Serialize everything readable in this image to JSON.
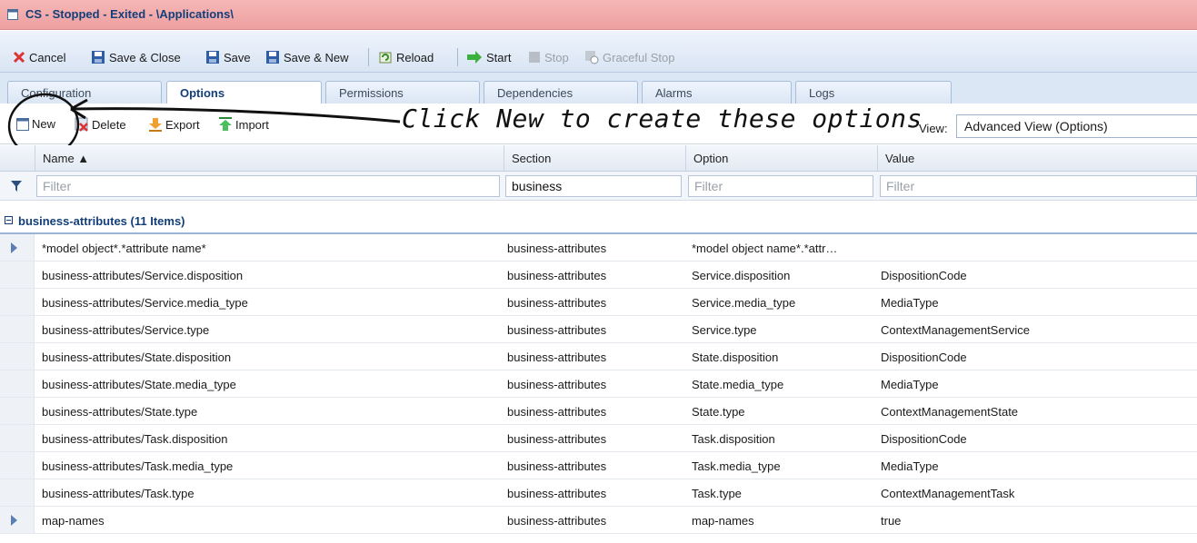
{
  "window": {
    "title": "CS - Stopped - Exited - \\Applications\\"
  },
  "toolbar": {
    "cancel": "Cancel",
    "save_close": "Save & Close",
    "save": "Save",
    "save_new": "Save & New",
    "reload": "Reload",
    "start": "Start",
    "stop": "Stop",
    "graceful_stop": "Graceful Stop"
  },
  "tabs": [
    "Configuration",
    "Options",
    "Permissions",
    "Dependencies",
    "Alarms",
    "Logs"
  ],
  "grid_toolbar": {
    "new": "New",
    "delete": "Delete",
    "export": "Export",
    "import": "Import",
    "view_label": "View:",
    "view_value": "Advanced View (Options)"
  },
  "annotation": "Click New to create these options",
  "columns": [
    "Name ▲",
    "Section",
    "Option",
    "Value"
  ],
  "filters": {
    "name": "Filter",
    "section": "business",
    "option": "Filter",
    "value": "Filter"
  },
  "group": {
    "label": "business-attributes (11 Items)"
  },
  "rows": [
    {
      "name": "*model object*.*attribute name*",
      "section": "business-attributes",
      "option": "*model object name*.*attr…",
      "value": ""
    },
    {
      "name": "business-attributes/Service.disposition",
      "section": "business-attributes",
      "option": "Service.disposition",
      "value": "DispositionCode"
    },
    {
      "name": "business-attributes/Service.media_type",
      "section": "business-attributes",
      "option": "Service.media_type",
      "value": "MediaType"
    },
    {
      "name": "business-attributes/Service.type",
      "section": "business-attributes",
      "option": "Service.type",
      "value": "ContextManagementService"
    },
    {
      "name": "business-attributes/State.disposition",
      "section": "business-attributes",
      "option": "State.disposition",
      "value": "DispositionCode"
    },
    {
      "name": "business-attributes/State.media_type",
      "section": "business-attributes",
      "option": "State.media_type",
      "value": "MediaType"
    },
    {
      "name": "business-attributes/State.type",
      "section": "business-attributes",
      "option": "State.type",
      "value": "ContextManagementState"
    },
    {
      "name": "business-attributes/Task.disposition",
      "section": "business-attributes",
      "option": "Task.disposition",
      "value": "DispositionCode"
    },
    {
      "name": "business-attributes/Task.media_type",
      "section": "business-attributes",
      "option": "Task.media_type",
      "value": "MediaType"
    },
    {
      "name": "business-attributes/Task.type",
      "section": "business-attributes",
      "option": "Task.type",
      "value": "ContextManagementTask"
    },
    {
      "name": "map-names",
      "section": "business-attributes",
      "option": "map-names",
      "value": "true"
    }
  ],
  "icons": {
    "window": "window-icon",
    "cancel": "x-icon",
    "save": "floppy-icon",
    "reload": "reload-icon",
    "start": "green-arrow-icon",
    "stop": "stop-square-icon",
    "graceful_stop": "graceful-stop-icon",
    "new": "new-window-icon",
    "delete": "delete-icon",
    "export": "export-arrow-icon",
    "import": "import-arrow-icon",
    "filter": "funnel-icon",
    "expand": "triangle-right-icon"
  },
  "colors": {
    "titlebar": "#f6b6b6",
    "title_text": "#123f7a",
    "accent": "#5b7fb2"
  }
}
